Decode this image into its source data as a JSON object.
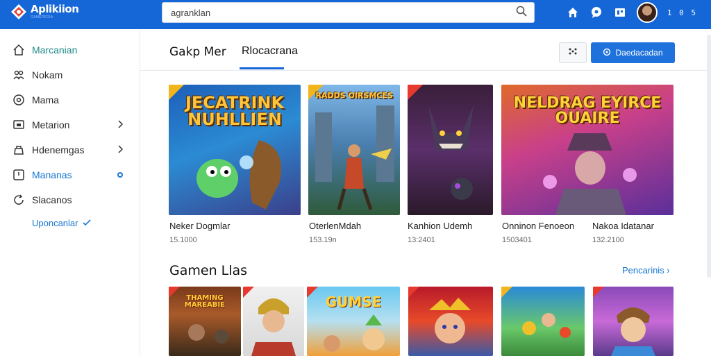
{
  "header": {
    "logo_name": "Aplikiion",
    "logo_sub": "GAMEPEDIA",
    "search_placeholder": "agranklan",
    "count_text": "1 0 5",
    "icons": [
      "home-icon",
      "chat-icon",
      "notification-icon",
      "avatar",
      "counter"
    ]
  },
  "sidebar": {
    "items": [
      {
        "label": "Marcanian",
        "icon": "home-icon",
        "state": "active"
      },
      {
        "label": "Nokam",
        "icon": "people-icon"
      },
      {
        "label": "Mama",
        "icon": "disc-icon"
      },
      {
        "label": "Metarion",
        "icon": "tv-icon",
        "chevron": true
      },
      {
        "label": "Hdenemgas",
        "icon": "bag-icon",
        "chevron": true
      },
      {
        "label": "Mananas",
        "icon": "frame-icon",
        "dot": true,
        "state": "blue"
      },
      {
        "label": "Slacanos",
        "icon": "refresh-icon"
      }
    ],
    "sub_link": "Uponcanlar"
  },
  "main": {
    "tabs": [
      "Gakp Mer",
      "Rlocacrana"
    ],
    "primary_button": "Daedacadan",
    "featured": [
      {
        "title": "JECATRINK NUHLLIEN",
        "name": "Neker Dogmlar",
        "count": "15.1000"
      },
      {
        "title": "RADDS OIRSMCES",
        "name": "OterlenMdah",
        "count": "153.19n"
      },
      {
        "title": "",
        "name": "Kanhion Udemh",
        "count": "13:2401"
      },
      {
        "title": "NELDRAG EYIRCE OUAIRE",
        "name": "Onninon Fenoeon",
        "count": "1503401"
      },
      {
        "title": "",
        "name": "Nakoa Idatanar",
        "count": "132.2100"
      }
    ],
    "section_title": "Gamen Llas",
    "section_link": "Pencarinis ›",
    "thumbs": [
      {
        "label": "THAMING MAREABIE"
      },
      {
        "label": ""
      },
      {
        "label": "GUMSE"
      },
      {
        "label": ""
      },
      {
        "label": ""
      },
      {
        "label": ""
      }
    ]
  },
  "colors": {
    "brand": "#1566d6",
    "accent_teal": "#1f8a8a",
    "link": "#1676d2"
  }
}
